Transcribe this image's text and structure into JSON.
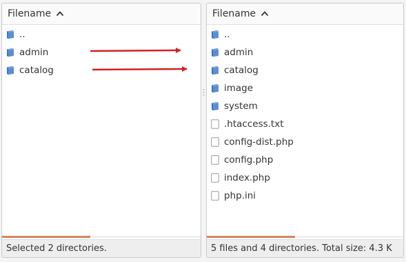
{
  "left_pane": {
    "header": {
      "label": "Filename",
      "sort": "ascending",
      "sort_icon": "chevron-up-icon"
    },
    "items": [
      {
        "name": "..",
        "type": "directory",
        "icon": "folder-icon"
      },
      {
        "name": "admin",
        "type": "directory",
        "icon": "folder-icon"
      },
      {
        "name": "catalog",
        "type": "directory",
        "icon": "folder-icon"
      }
    ],
    "status": "Selected 2 directories."
  },
  "right_pane": {
    "header": {
      "label": "Filename",
      "sort": "ascending",
      "sort_icon": "chevron-up-icon"
    },
    "items": [
      {
        "name": "..",
        "type": "directory",
        "icon": "folder-icon"
      },
      {
        "name": "admin",
        "type": "directory",
        "icon": "folder-icon"
      },
      {
        "name": "catalog",
        "type": "directory",
        "icon": "folder-icon"
      },
      {
        "name": "image",
        "type": "directory",
        "icon": "folder-icon"
      },
      {
        "name": "system",
        "type": "directory",
        "icon": "folder-icon"
      },
      {
        "name": ".htaccess.txt",
        "type": "file",
        "icon": "file-icon"
      },
      {
        "name": "config-dist.php",
        "type": "file",
        "icon": "file-icon"
      },
      {
        "name": "config.php",
        "type": "file",
        "icon": "file-icon"
      },
      {
        "name": "index.php",
        "type": "file",
        "icon": "file-icon"
      },
      {
        "name": "php.ini",
        "type": "file",
        "icon": "file-icon"
      }
    ],
    "status": "5 files and 4 directories. Total size: 4.3 K"
  },
  "annotations": {
    "arrow_color": "#d42020",
    "arrow_count": 2
  },
  "colors": {
    "folder": "#5b8fd4",
    "scrollbar_thumb": "#d7855e",
    "status_bg": "#eeeeee"
  }
}
